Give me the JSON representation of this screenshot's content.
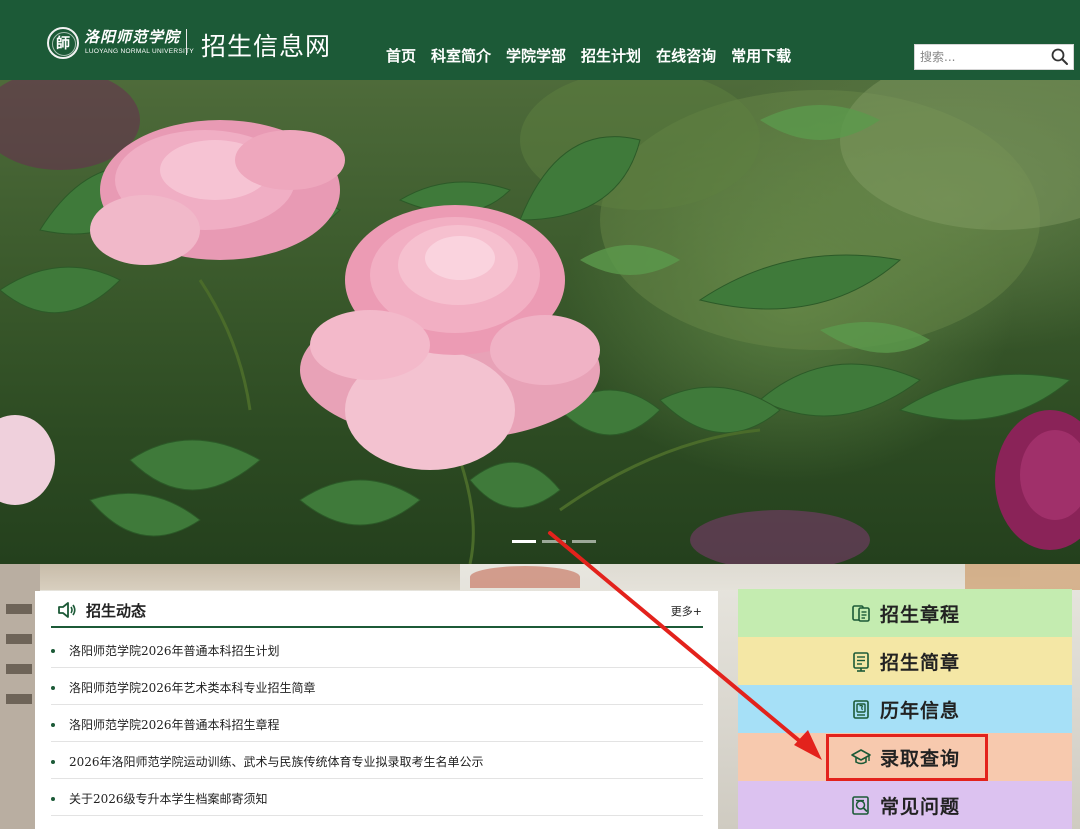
{
  "header": {
    "logo_cn": "洛阳师范学院",
    "logo_en": "LUOYANG NORMAL UNIVERSITY",
    "site_title": "招生信息网",
    "nav": [
      "首页",
      "科室简介",
      "学院学部",
      "招生计划",
      "在线咨询",
      "常用下载"
    ],
    "search_placeholder": "搜索..."
  },
  "hero": {
    "slide_count": 3,
    "active_slide": 1
  },
  "news": {
    "title": "招生动态",
    "more_label": "更多+",
    "items": [
      "洛阳师范学院2026年普通本科招生计划",
      "洛阳师范学院2026年艺术类本科专业招生简章",
      "洛阳师范学院2026年普通本科招生章程",
      "2026年洛阳师范学院运动训练、武术与民族传统体育专业拟录取考生名单公示",
      "关于2026级专升本学生档案邮寄须知"
    ]
  },
  "quick_links": [
    {
      "label": "招生章程",
      "icon": "document-icon",
      "color": "#c4ecb0"
    },
    {
      "label": "招生简章",
      "icon": "brochure-icon",
      "color": "#f4e7a5"
    },
    {
      "label": "历年信息",
      "icon": "history-icon",
      "color": "#a6e0f7"
    },
    {
      "label": "录取查询",
      "icon": "graduation-cap-icon",
      "color": "#f7c9ae"
    },
    {
      "label": "常见问题",
      "icon": "question-icon",
      "color": "#dcc2f0"
    }
  ],
  "colors": {
    "brand_green": "#1c5a37",
    "annotation_red": "#e3221c"
  }
}
